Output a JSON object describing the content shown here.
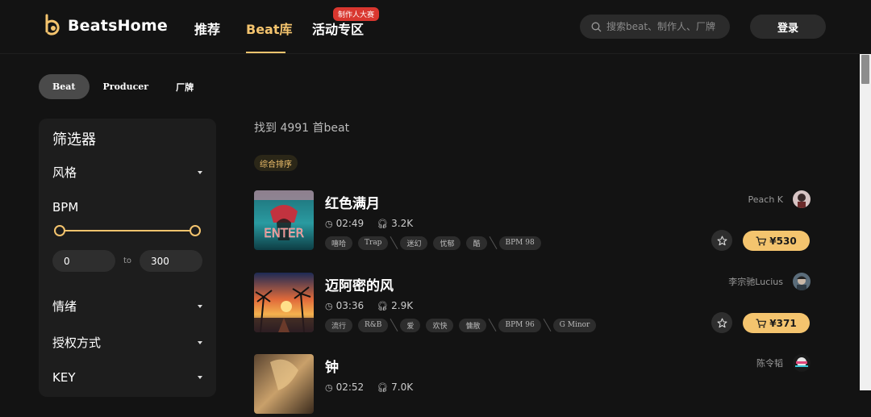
{
  "brand": {
    "name": "BeatsHome",
    "accent": "#f4c46e"
  },
  "nav": {
    "items": [
      {
        "label": "推荐"
      },
      {
        "label": "Beat库"
      },
      {
        "label": "活动专区"
      }
    ],
    "badge": "制作人大赛",
    "active": "Beat库"
  },
  "search": {
    "placeholder": "搜索beat、制作人、厂牌"
  },
  "auth": {
    "login_label": "登录"
  },
  "pill_tabs": [
    {
      "label": "Beat"
    },
    {
      "label": "Producer"
    },
    {
      "label": "厂牌"
    }
  ],
  "filter": {
    "title": "筛选器",
    "style_label": "风格",
    "bpm_label": "BPM",
    "bpm_min": "0",
    "bpm_max": "300",
    "to_label": "to",
    "mood_label": "情绪",
    "license_label": "授权方式",
    "key_label": "KEY"
  },
  "results": {
    "text": "找到 4991 首beat",
    "sort_label": "综合排序"
  },
  "tracks": [
    {
      "title": "红色满月",
      "duration": "02:49",
      "plays": "3.2K",
      "producer": "Peach K",
      "price": "¥530",
      "tags": [
        "嘻哈",
        "Trap",
        "迷幻",
        "忧郁",
        "酷",
        "BPM 98"
      ],
      "cover_text": "ENTER"
    },
    {
      "title": "迈阿密的风",
      "duration": "03:36",
      "plays": "2.9K",
      "producer": "李宗驰Lucius",
      "price": "¥371",
      "tags": [
        "流行",
        "R&B",
        "爱",
        "欢快",
        "慵散",
        "BPM 96",
        "G Minor"
      ]
    },
    {
      "title": "钟",
      "duration": "02:52",
      "plays": "7.0K",
      "producer": "陈令韬"
    }
  ]
}
